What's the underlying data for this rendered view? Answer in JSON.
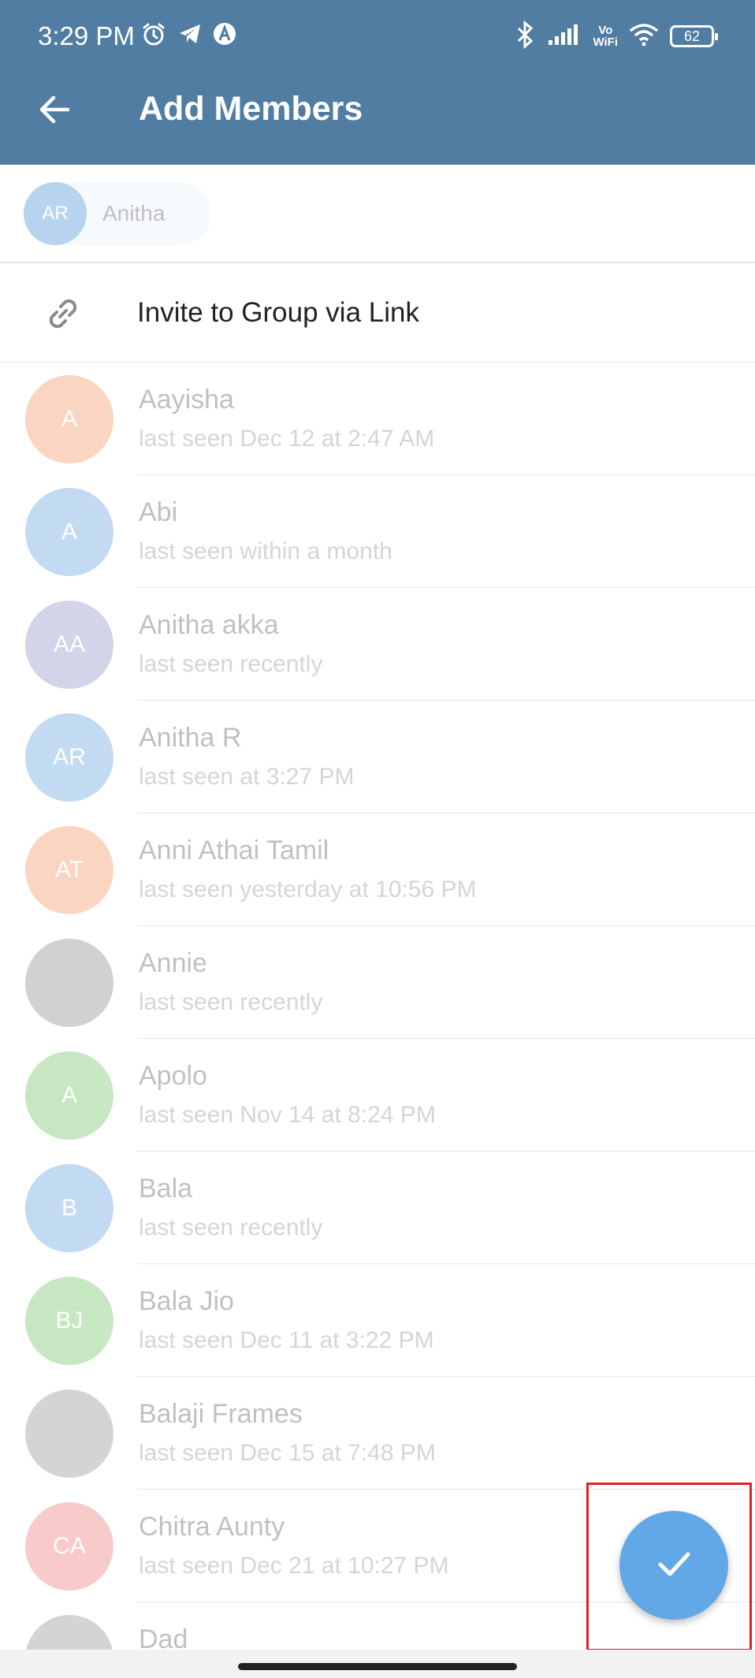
{
  "status_bar": {
    "time": "3:29 PM",
    "vowifi_top": "Vo",
    "vowifi_bottom": "WiFi",
    "battery": "62",
    "icons": [
      "alarm-icon",
      "telegram-icon",
      "app-icon",
      "bluetooth-icon",
      "signal-icon",
      "vowifi-icon",
      "wifi-icon",
      "battery-icon"
    ]
  },
  "header": {
    "title": "Add Members",
    "back_icon": "back-arrow-icon"
  },
  "selected": {
    "chip_initials": "AR",
    "chip_label": "Anitha"
  },
  "invite": {
    "label": "Invite to Group via Link",
    "icon": "link-icon"
  },
  "contacts": [
    {
      "name": "Aayisha",
      "status": "last seen Dec 12 at 2:47 AM",
      "initials": "A",
      "color": "#f4a477"
    },
    {
      "name": "Abi",
      "status": "last seen within a month",
      "initials": "A",
      "color": "#79aee3"
    },
    {
      "name": "Anitha akka",
      "status": "last seen recently",
      "initials": "AA",
      "color": "#9f9fcf"
    },
    {
      "name": "Anitha R",
      "status": "last seen at 3:27 PM",
      "initials": "AR",
      "color": "#79aee3"
    },
    {
      "name": "Anni Athai Tamil",
      "status": "last seen yesterday at 10:56 PM",
      "initials": "AT",
      "color": "#f4a477"
    },
    {
      "name": "Annie",
      "status": "last seen recently",
      "initials": "",
      "color": "#9a9a9a"
    },
    {
      "name": "Apolo",
      "status": "last seen Nov 14 at 8:24 PM",
      "initials": "A",
      "color": "#85c97a"
    },
    {
      "name": "Bala",
      "status": "last seen recently",
      "initials": "B",
      "color": "#79aee3"
    },
    {
      "name": "Bala Jio",
      "status": "last seen Dec 11 at 3:22 PM",
      "initials": "BJ",
      "color": "#85c97a"
    },
    {
      "name": "Balaji Frames",
      "status": "last seen Dec 15 at 7:48 PM",
      "initials": "",
      "color": "#a0a0a0"
    },
    {
      "name": "Chitra Aunty",
      "status": "last seen Dec 21 at 10:27 PM",
      "initials": "CA",
      "color": "#f08c8c"
    },
    {
      "name": "Dad",
      "status": "",
      "initials": "",
      "color": "#a0a0a0"
    }
  ],
  "fab": {
    "icon": "checkmark-icon",
    "color": "#62a8e6"
  },
  "colors": {
    "app_bar": "#517da2",
    "highlight_box": "#e02020"
  }
}
